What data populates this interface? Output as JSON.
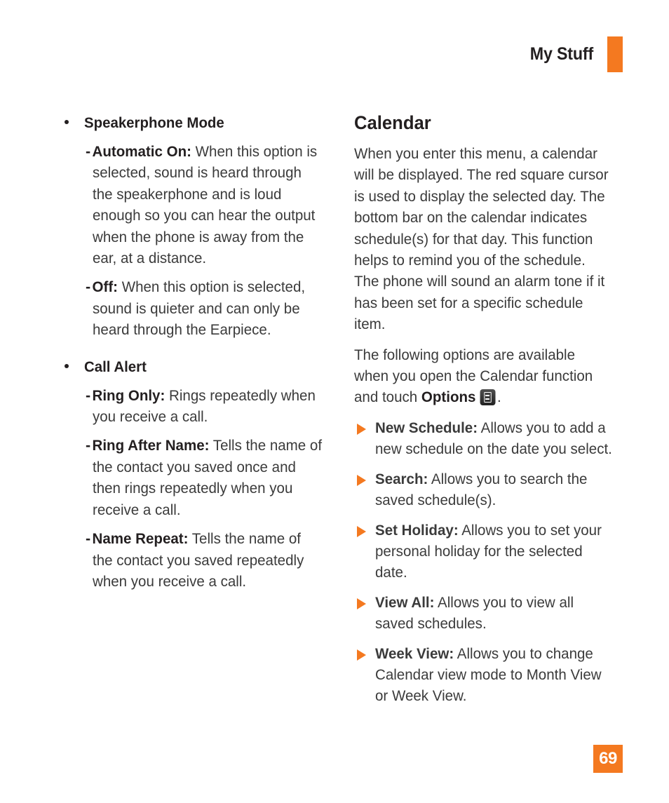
{
  "header": {
    "title": "My Stuff",
    "accent_color": "#F47920"
  },
  "page_number": "69",
  "left_column": {
    "groups": [
      {
        "label": "Speakerphone Mode",
        "items": [
          {
            "term": "Automatic On:",
            "text": " When this option is selected, sound is heard through the speakerphone and is loud enough so you can hear the output when the phone is away from the ear, at a distance."
          },
          {
            "term": "Off:",
            "text": " When this option is selected, sound is quieter and can only be heard through the Earpiece."
          }
        ]
      },
      {
        "label": "Call Alert",
        "items": [
          {
            "term": "Ring Only:",
            "text": " Rings repeatedly when you receive a call."
          },
          {
            "term": "Ring After Name:",
            "text": " Tells the name of the contact you saved once and then rings repeatedly when you receive a call."
          },
          {
            "term": "Name Repeat:",
            "text": " Tells the name of the contact you saved repeatedly when you receive a call."
          }
        ]
      }
    ]
  },
  "right_column": {
    "section_title": "Calendar",
    "paragraph_1": "When you enter this menu, a calendar will be displayed. The red square cursor is used to display the selected day. The bottom bar on the calendar indicates schedule(s) for that day. This function helps to remind you of the schedule. The phone will sound an alarm tone if it has been set for a specific schedule item.",
    "paragraph_2_pre": "The following options are available when you open the Calendar function and touch ",
    "paragraph_2_bold": "Options",
    "paragraph_2_post": ".",
    "options_icon_name": "options-menu-icon",
    "options": [
      {
        "term": "New Schedule:",
        "text": " Allows you to add a new schedule on the date you select."
      },
      {
        "term": "Search:",
        "text": " Allows you to search the saved schedule(s)."
      },
      {
        "term": "Set Holiday:",
        "text": " Allows you to set your personal holiday for the selected date."
      },
      {
        "term": "View All:",
        "text": " Allows you to view all saved schedules."
      },
      {
        "term": "Week View:",
        "text": " Allows you to change Calendar view mode to Month View or Week View."
      }
    ]
  }
}
